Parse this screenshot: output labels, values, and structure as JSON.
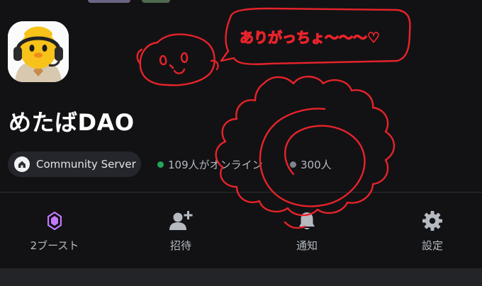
{
  "server": {
    "name": "めたばDAO",
    "type_label": "Community Server",
    "online_count": "109人がオンライン",
    "member_count": "300人"
  },
  "actions": [
    {
      "label": "2ブースト",
      "icon": "boost-gem-icon"
    },
    {
      "label": "招待",
      "icon": "add-user-icon"
    },
    {
      "label": "通知",
      "icon": "bell-icon"
    },
    {
      "label": "設定",
      "icon": "gear-icon"
    }
  ],
  "doodle": {
    "speech_text": "ありがっちょ〜〜〜♡"
  },
  "colors": {
    "background": "#121214",
    "pill": "#25262b",
    "online_dot": "#23a55a",
    "member_dot": "#80848e",
    "boost": "#c47aff",
    "doodle_ink": "#e8232a"
  }
}
